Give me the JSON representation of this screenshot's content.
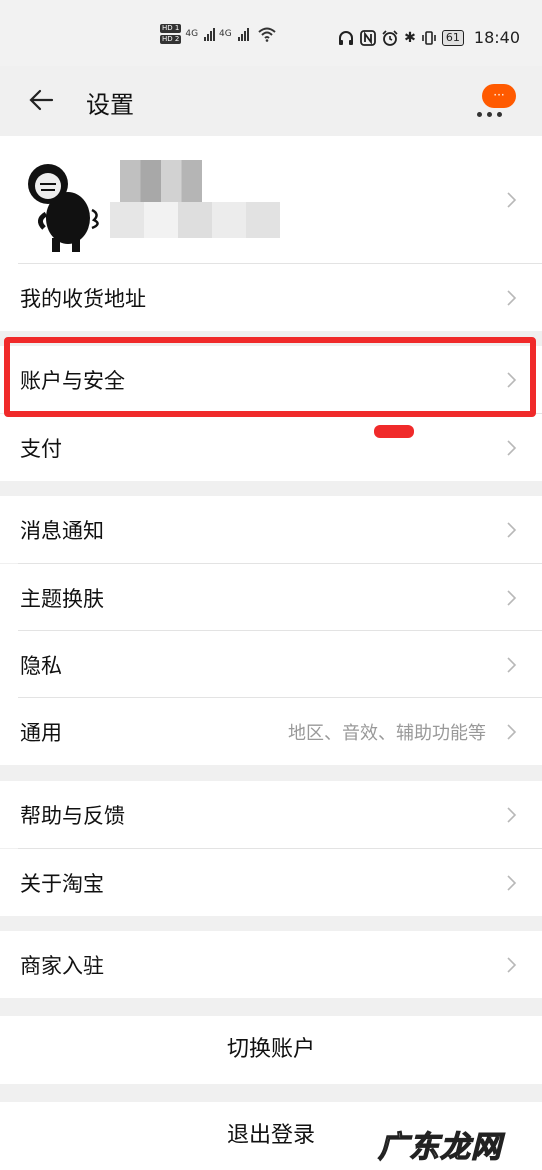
{
  "status_bar": {
    "hd1": "HD 1",
    "hd2": "HD 2",
    "net1": "4G",
    "net2": "4G",
    "battery": "61",
    "time": "18:40"
  },
  "header": {
    "title": "设置",
    "badge_text": "···",
    "icons": [
      "back-arrow-icon",
      "more-icon"
    ]
  },
  "profile": {
    "avatar_icon": "cartoon-avatar-icon"
  },
  "menu": {
    "address": "我的收货地址",
    "account_security": "账户与安全",
    "payment": "支付",
    "notifications": "消息通知",
    "theme": "主题换肤",
    "privacy": "隐私",
    "general": "通用",
    "general_sub": "地区、音效、辅助功能等",
    "help": "帮助与反馈",
    "about": "关于淘宝",
    "merchant": "商家入驻"
  },
  "actions": {
    "switch_account": "切换账户",
    "logout": "退出登录"
  },
  "watermark": "广东龙网",
  "colors": {
    "accent": "#ff5a00",
    "highlight": "#f02a2a",
    "background": "#f0f0f0"
  }
}
